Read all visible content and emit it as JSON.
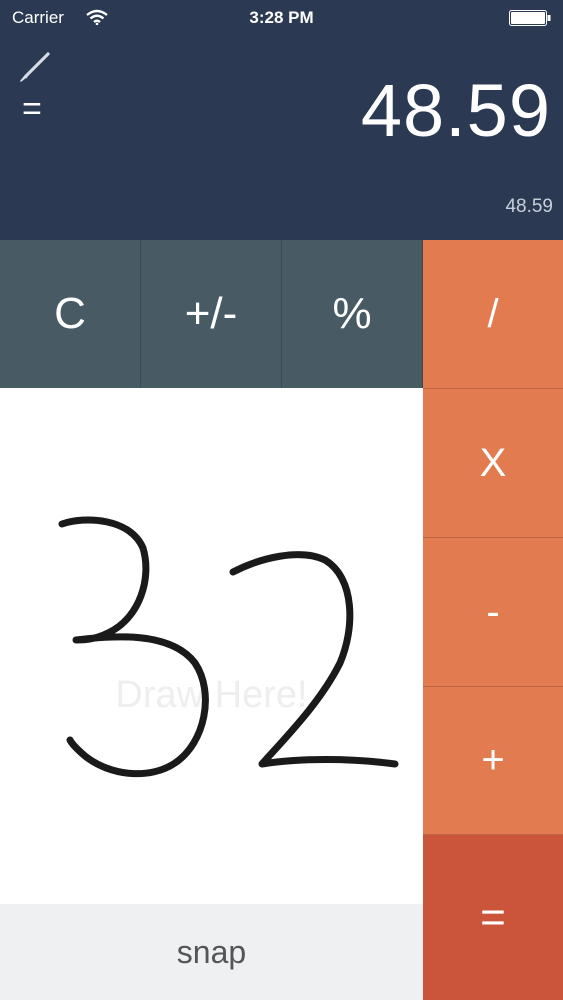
{
  "status_bar": {
    "carrier": "Carrier",
    "time": "3:28 PM",
    "wifi_icon": "wifi-icon",
    "battery_icon": "battery-icon"
  },
  "header": {
    "edit_icon": "pencil-icon",
    "equals": "=",
    "display": "48.59",
    "sub_display": "48.59",
    "background": "#2b3a52"
  },
  "keys": {
    "clear": "C",
    "sign": "+/-",
    "percent": "%",
    "divide": "/",
    "multiply": "X",
    "subtract": "-",
    "add": "+",
    "equals": "="
  },
  "canvas": {
    "hint": "Draw Here!",
    "snap_label": "snap"
  },
  "colors": {
    "gray_key": "#485a64",
    "orange_key": "#e27c50",
    "equals_key": "#cb553a"
  }
}
